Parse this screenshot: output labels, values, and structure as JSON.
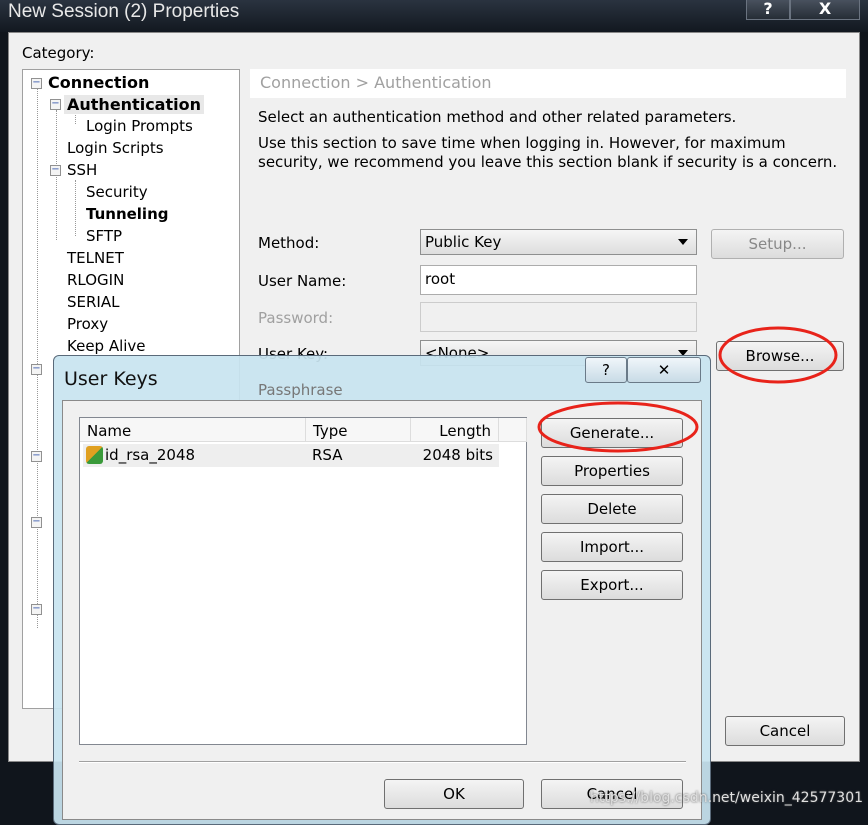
{
  "window": {
    "title": "New Session (2) Properties",
    "help": "?",
    "close": "X"
  },
  "category_label": "Category:",
  "tree": [
    {
      "label": "Connection",
      "bold": true
    },
    {
      "label": "Authentication",
      "bold": true
    },
    {
      "label": "Login Prompts"
    },
    {
      "label": "Login Scripts"
    },
    {
      "label": "SSH"
    },
    {
      "label": "Security"
    },
    {
      "label": "Tunneling",
      "bold": true
    },
    {
      "label": "SFTP"
    },
    {
      "label": "TELNET"
    },
    {
      "label": "RLOGIN"
    },
    {
      "label": "SERIAL"
    },
    {
      "label": "Proxy"
    },
    {
      "label": "Keep Alive"
    }
  ],
  "panel": {
    "breadcrumb": "Connection > Authentication",
    "desc1": "Select an authentication method and other related parameters.",
    "desc2": "Use this section to save time when logging in. However, for maximum security, we recommend you leave this section blank if security is a concern.",
    "method_label": "Method:",
    "method_value": "Public Key",
    "setup": "Setup...",
    "username_label": "User Name:",
    "username_value": "root",
    "password_label": "Password:",
    "userkey_label": "User Key:",
    "userkey_value": "<None>",
    "browse": "Browse...",
    "passphrase_label": "Passphrase"
  },
  "cancel": "Cancel",
  "dialog": {
    "title": "User Keys",
    "help": "?",
    "close": "✕",
    "columns": [
      "Name",
      "Type",
      "Length"
    ],
    "rows": [
      {
        "name": "id_rsa_2048",
        "type": "RSA",
        "length": "2048 bits"
      }
    ],
    "buttons": {
      "generate": "Generate...",
      "properties": "Properties",
      "delete": "Delete",
      "import": "Import...",
      "export": "Export..."
    },
    "ok": "OK",
    "cancel": "Cancel"
  },
  "watermark": "https://blog.csdn.net/weixin_42577301",
  "annotation_color": "#e8231a"
}
